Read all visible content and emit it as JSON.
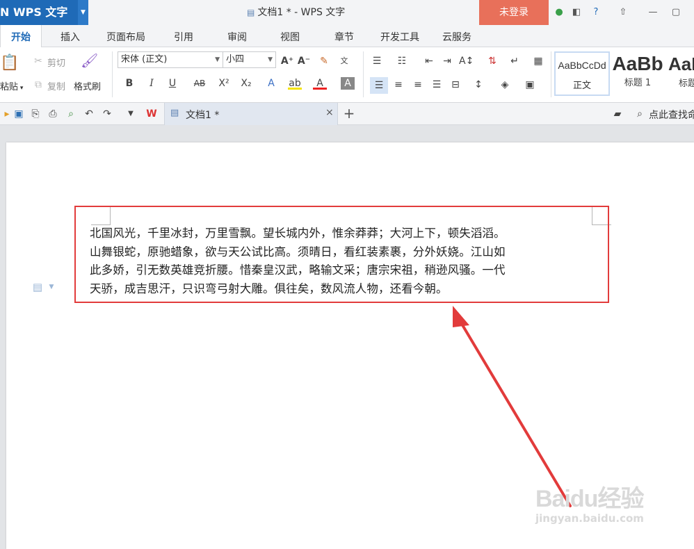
{
  "titlebar": {
    "app_name": "N  WPS 文字",
    "doc_title": "文档1 * - WPS 文字",
    "login_label": "未登录"
  },
  "menu": {
    "tabs": [
      "开始",
      "插入",
      "页面布局",
      "引用",
      "审阅",
      "视图",
      "章节",
      "开发工具",
      "云服务"
    ]
  },
  "ribbon": {
    "paste_label": "粘贴",
    "cut_label": "剪切",
    "copy_label": "复制",
    "format_painter_label": "格式刷",
    "font_name": "宋体 (正文)",
    "font_size": "小四",
    "styles": [
      {
        "preview": "AaBbCcDd",
        "label": "正文"
      },
      {
        "preview": "AaBb",
        "label": "标题 1"
      },
      {
        "preview": "AaB",
        "label": "标题"
      }
    ]
  },
  "tabsbar": {
    "doc_tab_label": "文档1 *",
    "search_label": "点此查找命"
  },
  "document": {
    "lines": [
      "北国风光，千里冰封，万里雪飘。望长城内外，惟余莽莽；大河上下，顿失滔滔。",
      "山舞银蛇，原驰蜡象，欲与天公试比高。须晴日，看红装素裹，分外妖娆。江山如",
      "此多娇，引无数英雄竞折腰。惜秦皇汉武，略输文采；唐宗宋祖，稍逊风骚。一代",
      "天骄，成吉思汗，只识弯弓射大雕。俱往矣，数风流人物，还看今朝。"
    ]
  },
  "watermark": {
    "brand": "Baidu经验",
    "url": "jingyan.baidu.com"
  },
  "colors": {
    "brand_blue": "#1f6ab7",
    "login_bg": "#e8705a",
    "annotation_red": "#e23b3b"
  }
}
